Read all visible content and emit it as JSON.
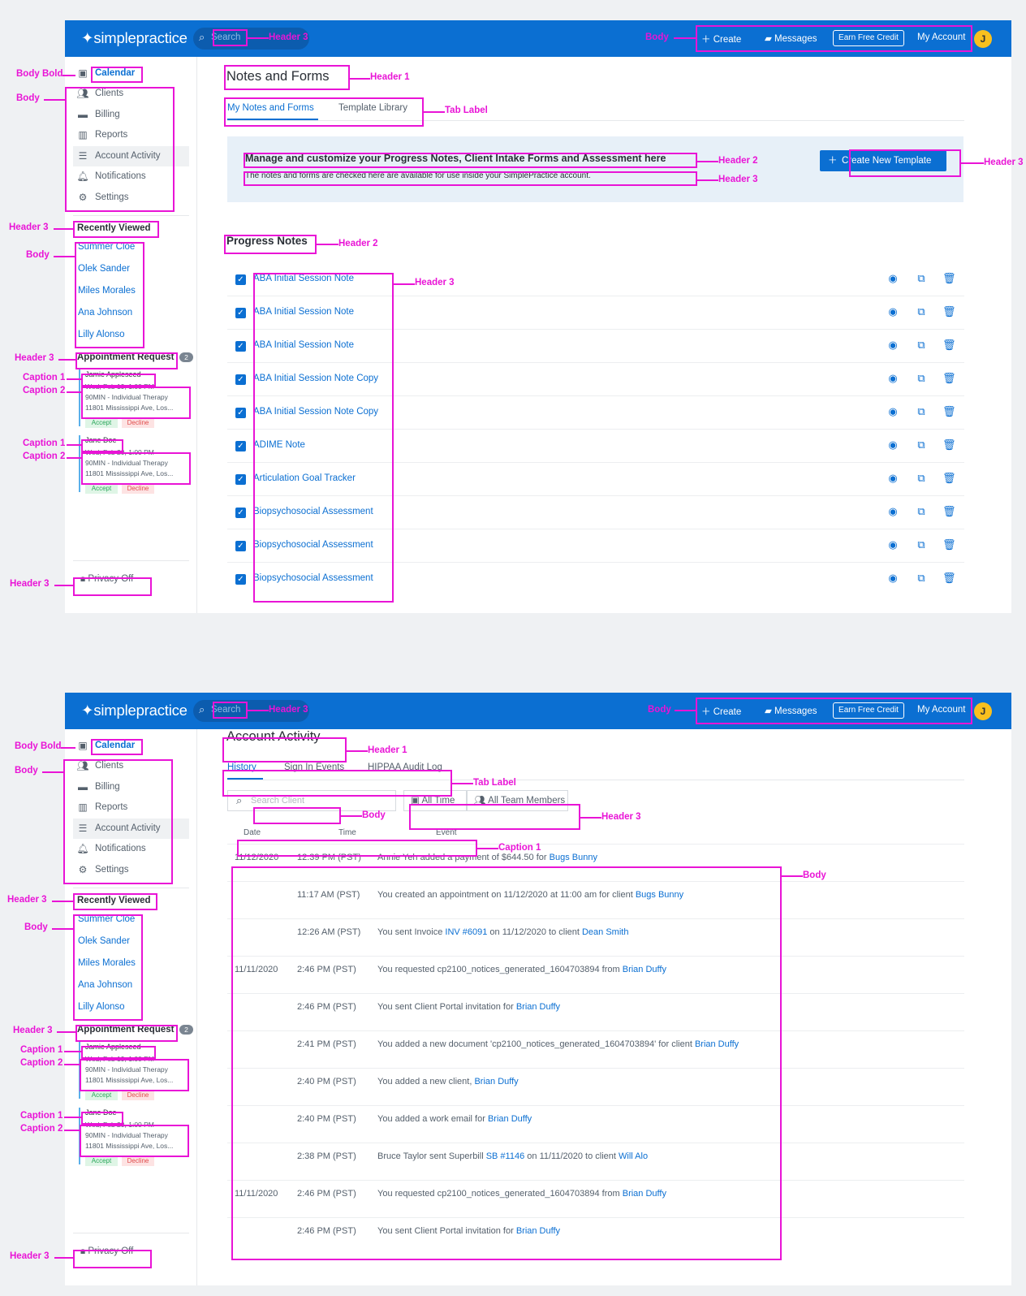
{
  "brand": {
    "logo_text": "simplepractice"
  },
  "top_nav": {
    "search_placeholder": "Search",
    "create": "Create",
    "messages": "Messages",
    "earn_credit": "Earn Free Credit",
    "my_account": "My Account",
    "avatar_initial": "J"
  },
  "sidebar": {
    "items": [
      {
        "label": "Calendar",
        "icon": "calendar-icon"
      },
      {
        "label": "Clients",
        "icon": "users-icon"
      },
      {
        "label": "Billing",
        "icon": "credit-card-icon"
      },
      {
        "label": "Reports",
        "icon": "bar-chart-icon"
      },
      {
        "label": "Account Activity",
        "icon": "list-icon"
      },
      {
        "label": "Notifications",
        "icon": "bell-icon"
      },
      {
        "label": "Settings",
        "icon": "gear-icon"
      }
    ],
    "recently_viewed_title": "Recently Viewed",
    "recently_viewed": [
      "Summer Cloe",
      "Olek Sander",
      "Miles Morales",
      "Ana Johnson",
      "Lilly Alonso"
    ],
    "appointment_title": "Appointment Request",
    "appointment_count": "2",
    "requests": [
      {
        "name": "Jamie Appleseed",
        "lines": [
          "Wed, Feb 19, 1:00 PM",
          "90MIN - Individual Therapy",
          "11801 Mississippi Ave, Los..."
        ],
        "accept": "Accept",
        "decline": "Decline"
      },
      {
        "name": "Jane Doe",
        "lines": [
          "Wed, Feb 20, 1:00 PM",
          "90MIN - Individual Therapy",
          "11801 Mississippi Ave, Los..."
        ],
        "accept": "Accept",
        "decline": "Decline"
      }
    ],
    "privacy": "Privacy Off"
  },
  "notes_page": {
    "title": "Notes and Forms",
    "tabs": [
      "My Notes and Forms",
      "Template Library"
    ],
    "banner_title": "Manage and customize your Progress Notes, Client Intake Forms and Assessment here",
    "banner_sub": "The notes and forms are checked here are available for use inside your SimplePractice account.",
    "create_button": "Create New Template",
    "section": "Progress Notes",
    "notes": [
      "ABA Initial Session Note",
      "ABA Initial Session Note",
      "ABA Initial Session Note",
      "ABA Initial Session Note Copy",
      "ABA Initial Session Note Copy",
      "ADIME Note",
      "Articulation Goal Tracker",
      "Biopsychosocial Assessment",
      "Biopsychosocial Assessment",
      "Biopsychosocial Assessment"
    ]
  },
  "activity_page": {
    "title": "Account Activity",
    "tabs": [
      "History",
      "Sign In Events",
      "HIPPAA Audit Log"
    ],
    "search_placeholder": "Search Client",
    "filter_time": "All Time",
    "filter_team": "All Team Members",
    "columns": [
      "Date",
      "Time",
      "Event"
    ],
    "rows": [
      {
        "date": "11/12/2020",
        "time": "12:39 PM (PST)",
        "pre": "Annie Yeh added a payment of $644.50 for ",
        "link": "Bugs Bunny",
        "mid": "",
        "link2": "",
        "post": ""
      },
      {
        "date": "",
        "time": "11:17 AM (PST)",
        "pre": "You created an appointment on 11/12/2020 at 11:00 am for client ",
        "link": "Bugs Bunny",
        "mid": "",
        "link2": "",
        "post": ""
      },
      {
        "date": "",
        "time": "12:26 AM (PST)",
        "pre": "You sent Invoice ",
        "link": "INV #6091",
        "mid": " on 11/12/2020 to client ",
        "link2": "Dean Smith",
        "post": ""
      },
      {
        "date": "11/11/2020",
        "time": "2:46 PM (PST)",
        "pre": "You requested cp2100_notices_generated_1604703894 from ",
        "link": "Brian Duffy",
        "mid": "",
        "link2": "",
        "post": ""
      },
      {
        "date": "",
        "time": "2:46 PM (PST)",
        "pre": "You sent Client Portal invitation for ",
        "link": "Brian Duffy",
        "mid": "",
        "link2": "",
        "post": ""
      },
      {
        "date": "",
        "time": "2:41 PM (PST)",
        "pre": "You added a new document 'cp2100_notices_generated_1604703894' for client ",
        "link": "Brian Duffy",
        "mid": "",
        "link2": "",
        "post": ""
      },
      {
        "date": "",
        "time": "2:40 PM (PST)",
        "pre": "You added a new client, ",
        "link": "Brian Duffy",
        "mid": "",
        "link2": "",
        "post": ""
      },
      {
        "date": "",
        "time": "2:40 PM (PST)",
        "pre": "You added a work email for ",
        "link": "Brian Duffy",
        "mid": "",
        "link2": "",
        "post": ""
      },
      {
        "date": "",
        "time": "2:38 PM (PST)",
        "pre": "Bruce Taylor sent Superbill ",
        "link": "SB #1146",
        "mid": " on 11/11/2020 to client ",
        "link2": "Will Alo",
        "post": ""
      },
      {
        "date": "11/11/2020",
        "time": "2:46 PM (PST)",
        "pre": "You requested cp2100_notices_generated_1604703894 from ",
        "link": "Brian Duffy",
        "mid": "",
        "link2": "",
        "post": ""
      },
      {
        "date": "",
        "time": "2:46 PM (PST)",
        "pre": "You sent Client Portal invitation for ",
        "link": "Brian Duffy",
        "mid": "",
        "link2": "",
        "post": ""
      }
    ]
  },
  "annotations": {
    "header1": "Header 1",
    "header2": "Header 2",
    "header3": "Header 3",
    "body": "Body",
    "body_bold": "Body Bold",
    "tab_label": "Tab Label",
    "caption1": "Caption 1",
    "caption2": "Caption 2"
  },
  "colors": {
    "brand_blue": "#0b6fd2",
    "annotation_magenta": "#e914d6",
    "avatar_yellow": "#f9c01e"
  }
}
